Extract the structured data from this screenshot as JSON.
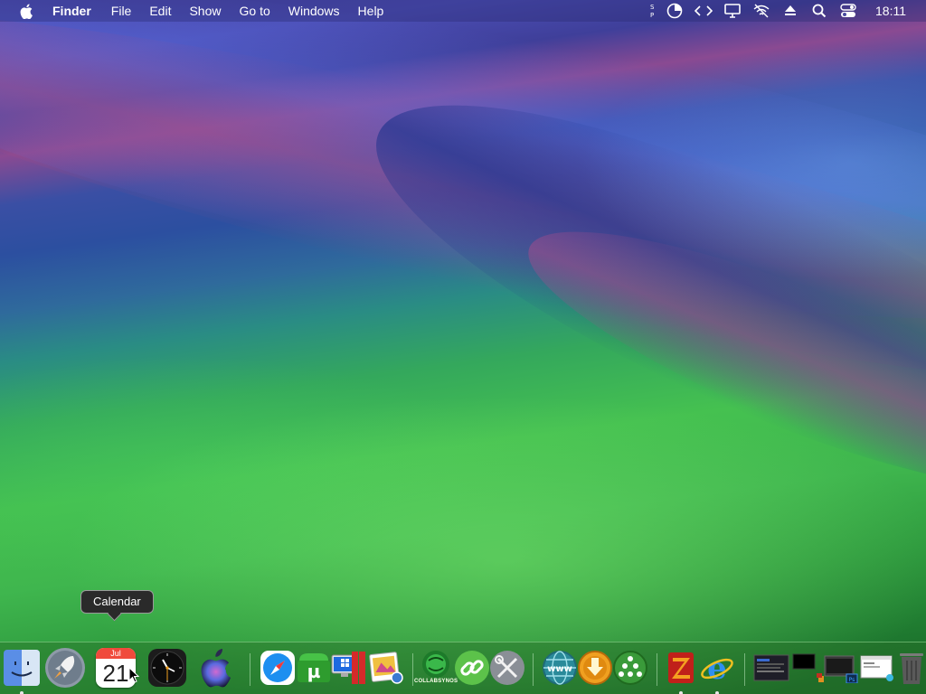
{
  "menubar": {
    "app_name": "Finder",
    "menus": [
      "File",
      "Edit",
      "Show",
      "Go to",
      "Windows",
      "Help"
    ],
    "status_icons": [
      "text-input-icon",
      "battery-pie-icon",
      "code-icon",
      "display-icon",
      "wifi-off-icon",
      "eject-icon",
      "search-icon",
      "control-center-icon"
    ],
    "clock": "18:11"
  },
  "tooltip": {
    "text": "Calendar"
  },
  "dock": {
    "calendar": {
      "month": "Jul",
      "day": "21"
    },
    "collab_label": "COLLABSYNOS",
    "items": [
      "finder",
      "launchpad",
      "calendar",
      "clock",
      "apple-logo-app",
      "safari",
      "utorrent",
      "parallels",
      "rar-archiver",
      "preview",
      "collabsynos",
      "link-tool",
      "system-tools",
      "www-browser",
      "downloader",
      "network-tool",
      "filezilla",
      "internet-explorer",
      "recent-window-1",
      "recent-window-2",
      "recent-window-3",
      "recent-window-4",
      "trash"
    ]
  },
  "colors": {
    "accent": "#3fb64e",
    "calendar_red": "#f04a3c"
  }
}
